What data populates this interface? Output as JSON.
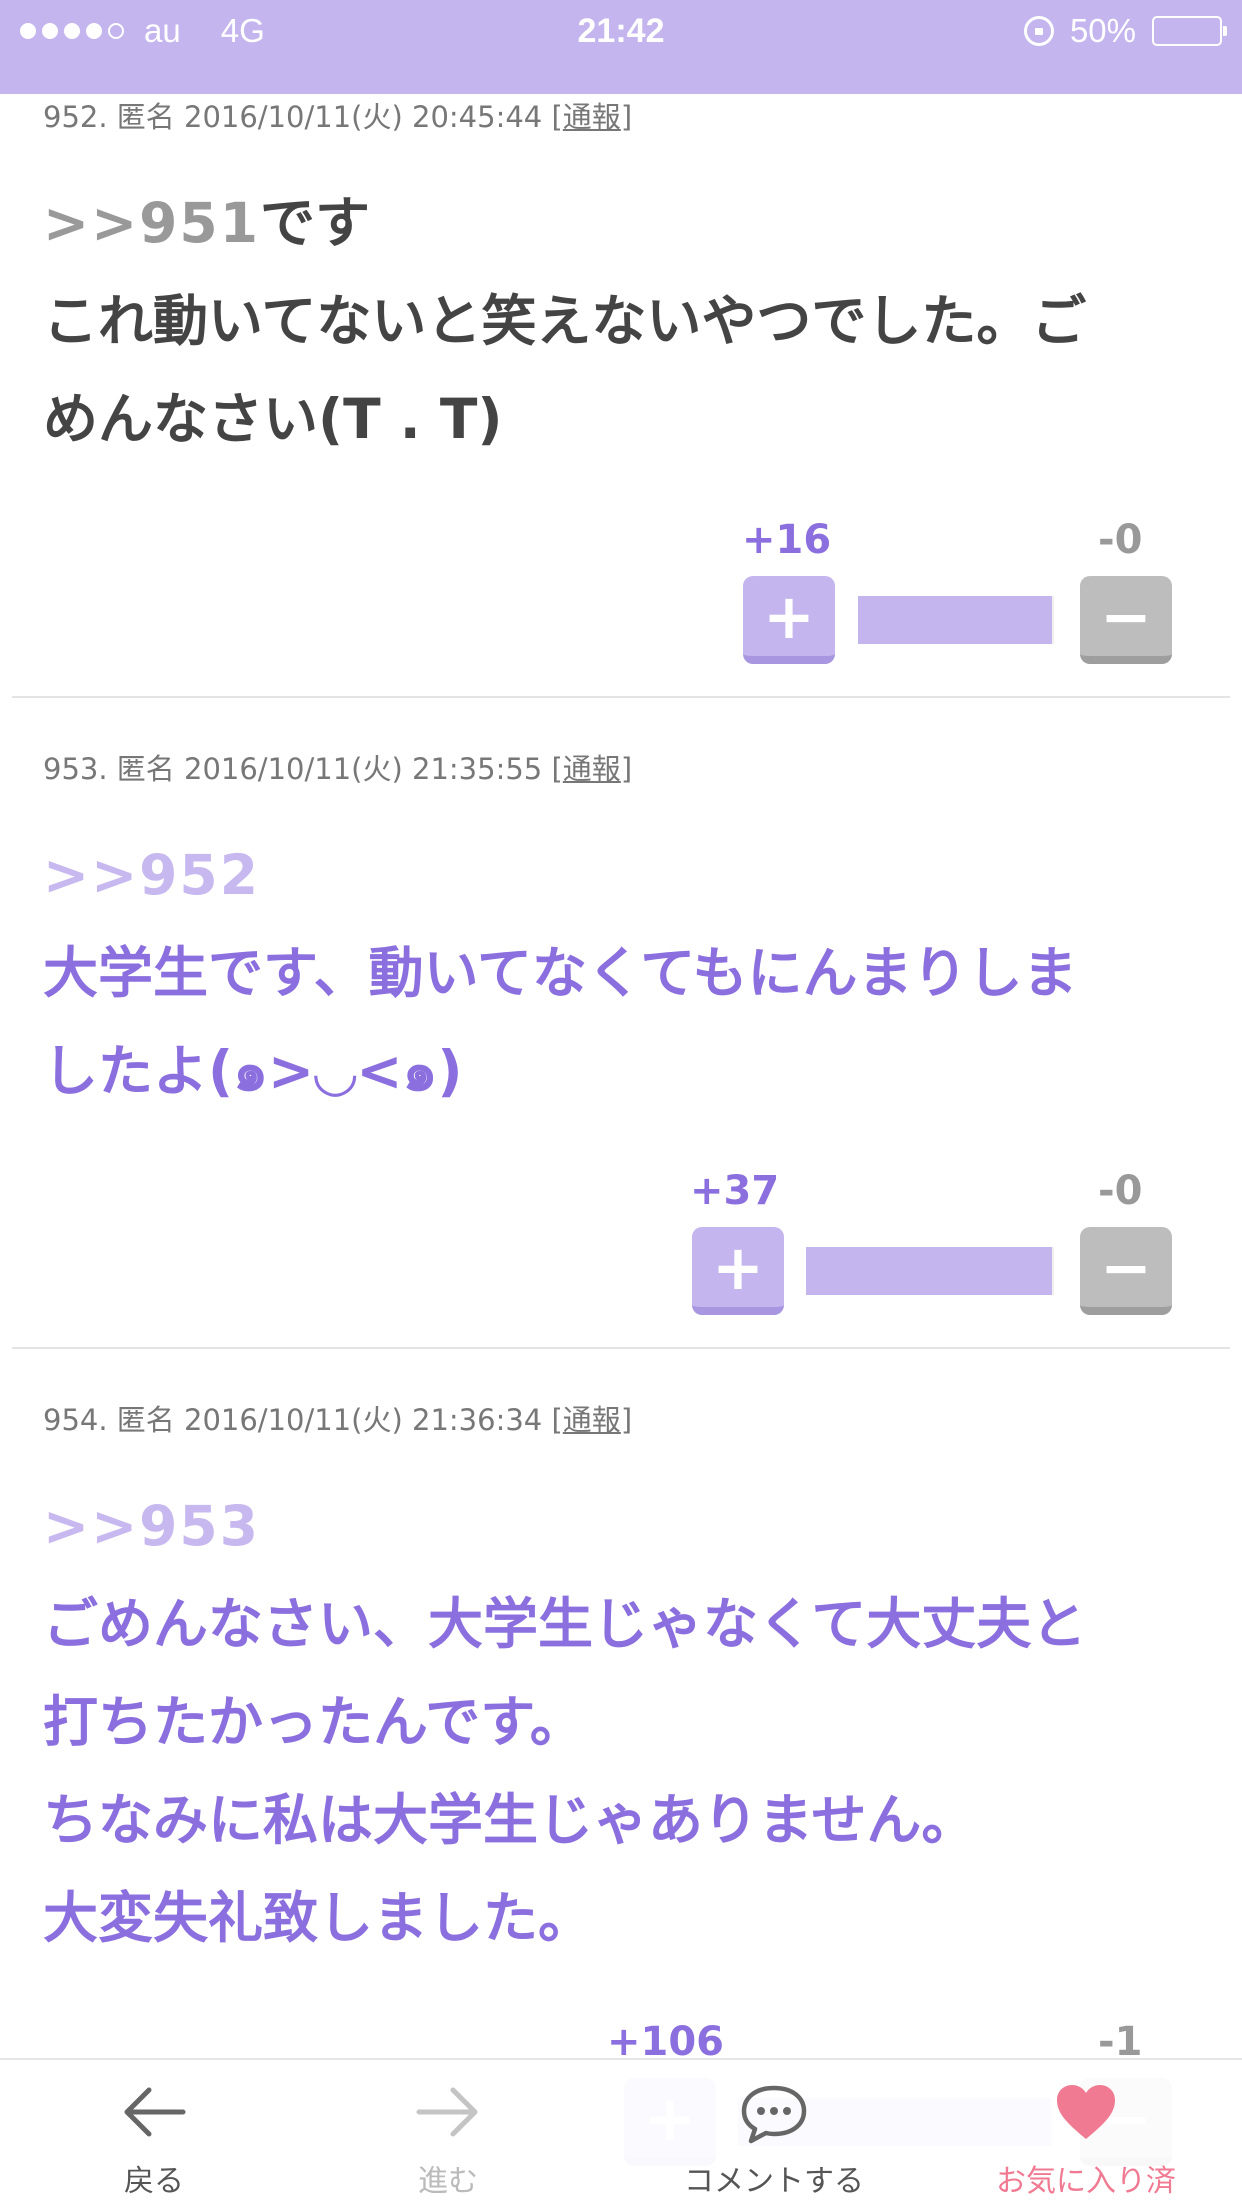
{
  "status_bar": {
    "carrier": "au",
    "network": "4G",
    "time": "21:42",
    "battery": "50%",
    "battery_level": 0.5,
    "signal_dots_filled": 4,
    "signal_dots_total": 5
  },
  "comments": [
    {
      "meta": "952. 匿名 2016/10/11(火) 20:45:44",
      "report_open": "[",
      "report_label": "通報",
      "report_close": "]",
      "anchor": ">>951",
      "first_line_rest": "です",
      "lines": [
        "これ動いてないと笑えないやつでした。ご",
        "めんなさい(T . T)"
      ],
      "plus": "+16",
      "minus": "-0",
      "plus_ratio": 0.99
    },
    {
      "meta": "953. 匿名 2016/10/11(火) 21:35:55",
      "report_open": "[",
      "report_label": "通報",
      "report_close": "]",
      "anchor": ">>952",
      "lines": [
        "大学生です、動いてなくてもにんまりしま",
        "したよ(๑>◡<๑)"
      ],
      "plus": "+37",
      "minus": "-0",
      "plus_ratio": 0.99
    },
    {
      "meta": "954. 匿名 2016/10/11(火) 21:36:34",
      "report_open": "[",
      "report_label": "通報",
      "report_close": "]",
      "anchor": ">>953",
      "lines": [
        "ごめんなさい、大学生じゃなくて大丈夫と",
        "打ちたかったんです。",
        "ちなみに私は大学生じゃありません。",
        "大変失礼致しました。"
      ],
      "plus": "+106",
      "minus": "-1",
      "plus_ratio": 0.99
    }
  ],
  "vote_symbols": {
    "plus": "+",
    "minus": "−"
  },
  "toolbar": {
    "back_label": "戻る",
    "forward_label": "進む",
    "comment_label": "コメントする",
    "favorite_label": "お気に入り済"
  },
  "colors": {
    "accent": "#c4b5ee",
    "accent_text": "#8b6fdf",
    "favorite": "#f07a92"
  }
}
